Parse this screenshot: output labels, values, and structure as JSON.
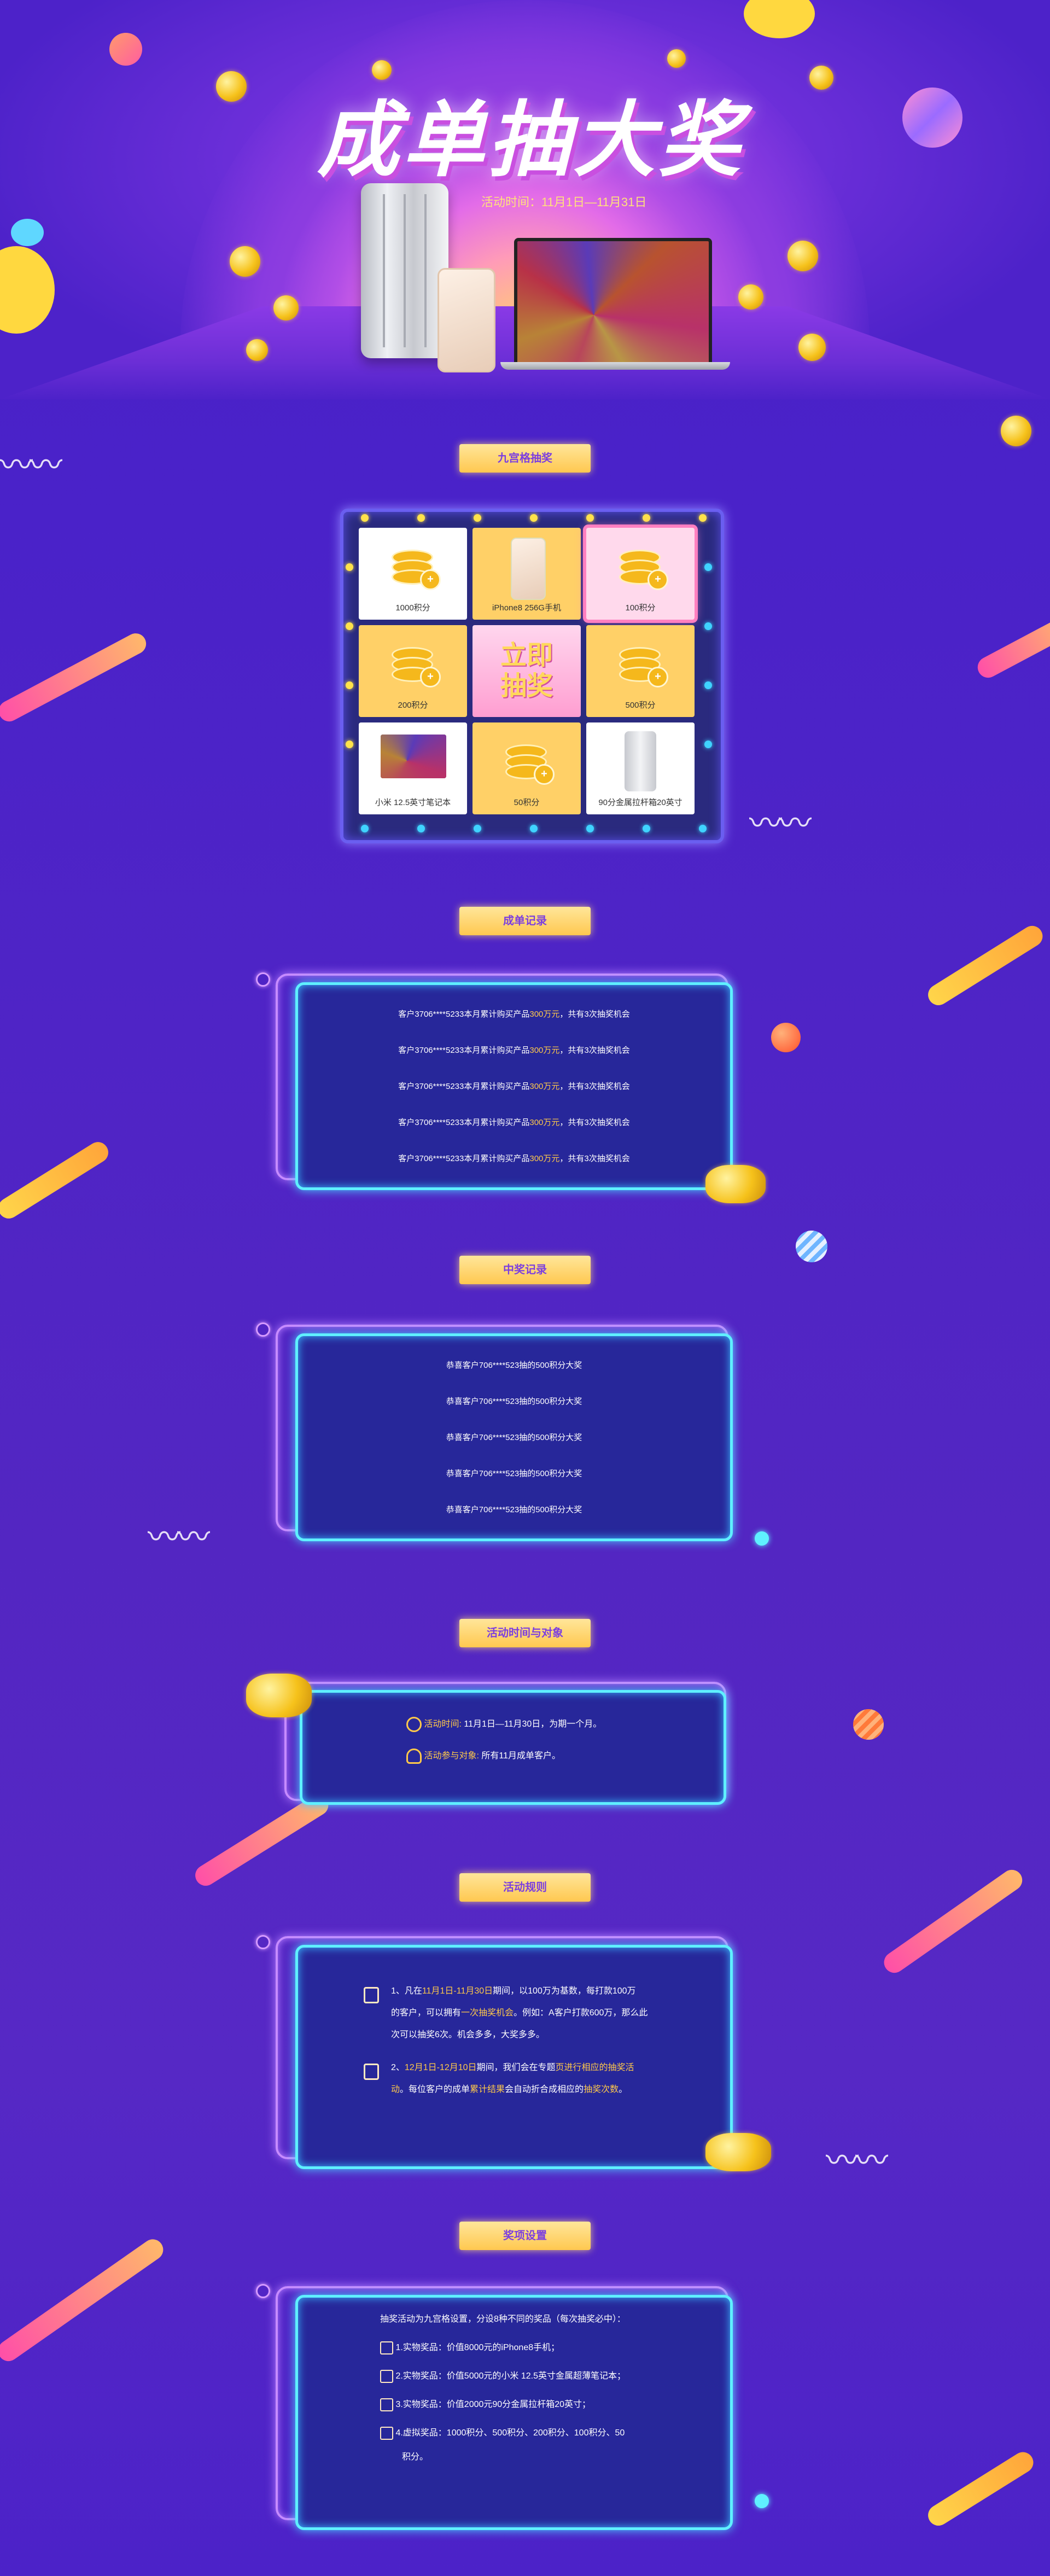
{
  "hero": {
    "title": "成单抽大奖",
    "time_text": "活动时间：11月1日—11月31日"
  },
  "sections": {
    "grid_title": "九宫格抽奖",
    "records_title": "成单记录",
    "winners_title": "中奖记录",
    "time_target_title": "活动时间与对象",
    "rules_title": "活动规则",
    "prizes_title": "奖项设置"
  },
  "grid": {
    "center_button": "立即抽奖",
    "cells": [
      "1000积分",
      "iPhone8 256G手机",
      "100积分",
      "200积分",
      "500积分",
      "小米 12.5英寸笔记本",
      "50积分",
      "90分金属拉杆箱20英寸"
    ]
  },
  "records": [
    {
      "prefix": "客户3706****5233本月累计购买产品",
      "amount": "300万元",
      "suffix": "，共有3次抽奖机会"
    },
    {
      "prefix": "客户3706****5233本月累计购买产品",
      "amount": "300万元",
      "suffix": "，共有3次抽奖机会"
    },
    {
      "prefix": "客户3706****5233本月累计购买产品",
      "amount": "300万元",
      "suffix": "，共有3次抽奖机会"
    },
    {
      "prefix": "客户3706****5233本月累计购买产品",
      "amount": "300万元",
      "suffix": "，共有3次抽奖机会"
    },
    {
      "prefix": "客户3706****5233本月累计购买产品",
      "amount": "300万元",
      "suffix": "，共有3次抽奖机会"
    }
  ],
  "winners": [
    "恭喜客户706****523抽的500积分大奖",
    "恭喜客户706****523抽的500积分大奖",
    "恭喜客户706****523抽的500积分大奖",
    "恭喜客户706****523抽的500积分大奖",
    "恭喜客户706****523抽的500积分大奖"
  ],
  "time_target": {
    "time_label": "活动时间:",
    "time_value": " 11月1日—11月30日，为期一个月。",
    "target_label": "活动参与对象:",
    "target_value": " 所有11月成单客户。"
  },
  "rules": {
    "r1_a": "1、凡在",
    "r1_b": "11月1日-11月30日",
    "r1_c": "期间，以100万为基数，每打款100万",
    "r1_d": "的客户，可以拥有",
    "r1_e": "一次抽奖机会",
    "r1_f": "。例如：A客户打款600万，那么此",
    "r1_g": "次可以抽奖6次。机会多多，大奖多多。",
    "r2_a": "2、",
    "r2_b": "12月1日-12月10日",
    "r2_c": "期间，我们会在专题",
    "r2_d": "页进行相应的抽奖活",
    "r2_e": "动",
    "r2_f": "。每位客户的成单",
    "r2_g": "累计结果",
    "r2_h": "会自动折合成相应的",
    "r2_i": "抽奖次数",
    "r2_j": "。"
  },
  "prizes": {
    "intro": "抽奖活动为九宫格设置，分设8种不同的奖品（每次抽奖必中）：",
    "p1": "1.实物奖品：价值8000元的iPhone8手机；",
    "p2": "2.实物奖品：价值5000元的小米 12.5英寸金属超薄笔记本；",
    "p3": "3.实物奖品：价值2000元90分金属拉杆箱20英寸；",
    "p4a": "4.虚拟奖品：1000积分、500积分、200积分、100积分、50",
    "p4b": "积分。"
  },
  "colors": {
    "background": "#4c22c8",
    "accent_yellow": "#ffc94a",
    "neon_cyan": "#5ff0ff",
    "neon_purple": "#c78bff",
    "panel": "#27279a"
  }
}
